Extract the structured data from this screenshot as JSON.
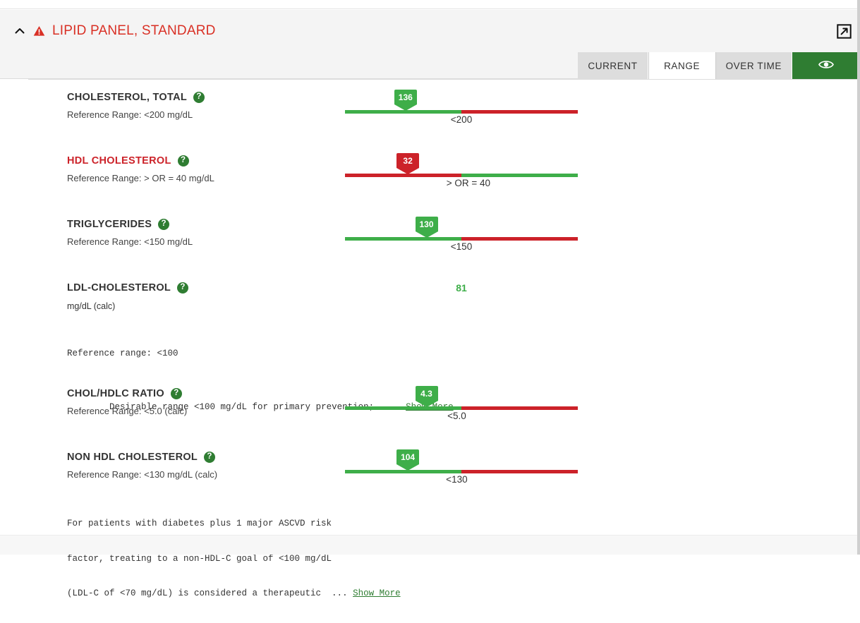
{
  "header": {
    "title": "LIPID PANEL, STANDARD",
    "collapse_icon": "chevron-up-icon",
    "warning_icon": "warning-triangle-icon",
    "expand_icon": "open-in-new-icon",
    "title_color": "#d93025"
  },
  "tabs": {
    "items": [
      {
        "label": "CURRENT",
        "active": false
      },
      {
        "label": "RANGE",
        "active": true
      },
      {
        "label": "OVER TIME",
        "active": false
      }
    ],
    "eye_button": {
      "icon": "eye-icon",
      "color": "#2f7d32"
    }
  },
  "colors": {
    "good": "#3eae49",
    "bad": "#cc2229",
    "accent": "#2f7d32"
  },
  "results": [
    {
      "name": "CHOLESTEROL, TOTAL",
      "name_abnormal": false,
      "reference_range": "Reference Range: <200 mg/dL",
      "display": "bar",
      "value": "136",
      "value_status": "good",
      "marker_pct": 26,
      "threshold_label": "<200",
      "threshold_pct": 50,
      "direction": "lower-is-better",
      "help_icon": "help-circle-icon"
    },
    {
      "name": "HDL CHOLESTEROL",
      "name_abnormal": true,
      "reference_range": "Reference Range: > OR = 40 mg/dL",
      "display": "bar",
      "value": "32",
      "value_status": "bad",
      "marker_pct": 27,
      "threshold_label": "> OR = 40",
      "threshold_pct": 53,
      "direction": "higher-is-better",
      "help_icon": "help-circle-icon"
    },
    {
      "name": "TRIGLYCERIDES",
      "name_abnormal": false,
      "reference_range": "Reference Range: <150 mg/dL",
      "display": "bar",
      "value": "130",
      "value_status": "good",
      "marker_pct": 35,
      "threshold_label": "<150",
      "threshold_pct": 50,
      "direction": "lower-is-better",
      "help_icon": "help-circle-icon"
    },
    {
      "name": "LDL-CHOLESTEROL",
      "name_abnormal": false,
      "display": "text",
      "value": "81",
      "value_status": "good",
      "unit": "mg/dL (calc)",
      "note_lines": [
        "Reference range: <100"
      ],
      "note_lines2": [
        "Desirable range <100 mg/dL for primary prevention;  ... "
      ],
      "show_more": "Show More",
      "help_icon": "help-circle-icon"
    },
    {
      "name": "CHOL/HDLC RATIO",
      "name_abnormal": false,
      "reference_range": "Reference Range: <5.0 (calc)",
      "display": "bar",
      "value": "4.3",
      "value_status": "good",
      "marker_pct": 35,
      "threshold_label": "<5.0",
      "threshold_pct": 48,
      "direction": "lower-is-better",
      "help_icon": "help-circle-icon"
    },
    {
      "name": "NON HDL CHOLESTEROL",
      "name_abnormal": false,
      "reference_range": "Reference Range: <130 mg/dL (calc)",
      "display": "bar-with-note",
      "value": "104",
      "value_status": "good",
      "marker_pct": 27,
      "threshold_label": "<130",
      "threshold_pct": 48,
      "direction": "lower-is-better",
      "help_icon": "help-circle-icon",
      "note_lines": [
        "For patients with diabetes plus 1 major ASCVD risk",
        "factor, treating to a non-HDL-C goal of <100 mg/dL",
        "(LDL-C of <70 mg/dL) is considered a therapeutic  ... "
      ],
      "show_more": "Show More"
    }
  ]
}
